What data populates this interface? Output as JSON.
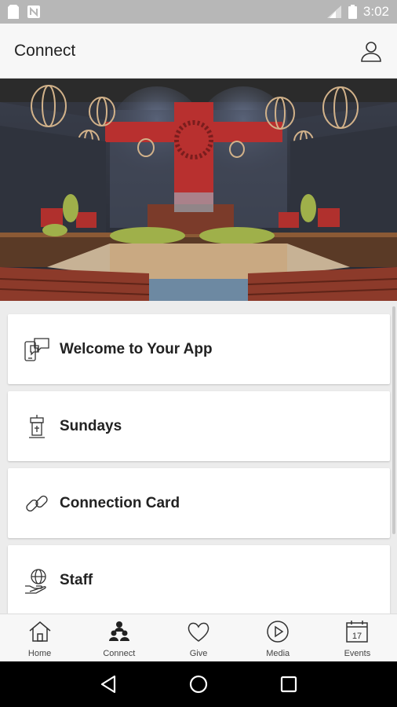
{
  "status_bar": {
    "time": "3:02"
  },
  "app_bar": {
    "title": "Connect"
  },
  "hero": {
    "alt": ""
  },
  "menu": [
    {
      "label": "Welcome to Your App",
      "icon": "chat-phone-icon"
    },
    {
      "label": "Sundays",
      "icon": "pulpit-icon"
    },
    {
      "label": "Connection Card",
      "icon": "link-icon"
    },
    {
      "label": "Staff",
      "icon": "globe-hand-icon"
    }
  ],
  "bottom_nav": [
    {
      "label": "Home",
      "icon": "home-icon"
    },
    {
      "label": "Connect",
      "icon": "people-icon",
      "active": true
    },
    {
      "label": "Give",
      "icon": "heart-icon"
    },
    {
      "label": "Media",
      "icon": "play-icon"
    },
    {
      "label": "Events",
      "icon": "calendar-icon",
      "day": "17"
    }
  ],
  "colors": {
    "status_bar": "#b7b7b7",
    "app_bar": "#f7f7f7",
    "background": "#ececec",
    "card": "#ffffff",
    "accent_red": "#b8302f"
  }
}
